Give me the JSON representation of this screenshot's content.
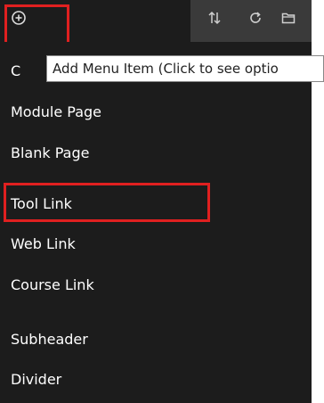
{
  "toolbar": {
    "icons": {
      "add": "add-circle-icon",
      "reorder": "reorder-arrows-icon",
      "refresh": "refresh-icon",
      "folder": "folder-icon"
    }
  },
  "tooltip": {
    "text": "Add Menu Item (Click to see optio"
  },
  "menu": {
    "items": [
      {
        "label": "C"
      },
      {
        "label": "Module Page"
      },
      {
        "label": "Blank Page"
      },
      {
        "label": "Tool Link"
      },
      {
        "label": "Web Link"
      },
      {
        "label": "Course Link"
      },
      {
        "label": "Subheader"
      },
      {
        "label": "Divider"
      }
    ]
  },
  "colors": {
    "background": "#1c1c1c",
    "toolbar_alt": "#3a3a3a",
    "highlight": "#e02020",
    "text": "#ffffff"
  }
}
